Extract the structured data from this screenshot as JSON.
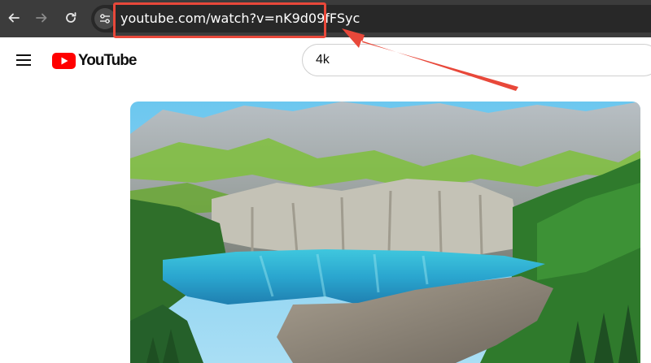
{
  "browser": {
    "url": "youtube.com/watch?v=nK9d09fFSyc",
    "colors": {
      "chrome_bg": "#3c3c3c",
      "omnibox_bg": "#282828",
      "highlight": "#e8483a"
    },
    "icons": [
      "back-arrow-icon",
      "forward-arrow-icon",
      "reload-icon",
      "site-settings-icon"
    ]
  },
  "youtube": {
    "logo_text": "YouTube",
    "search_value": "4k",
    "colors": {
      "brand_red": "#ff0000"
    },
    "icons": [
      "hamburger-menu-icon",
      "youtube-play-icon"
    ]
  },
  "video": {
    "scene": "Mountain lake landscape"
  }
}
